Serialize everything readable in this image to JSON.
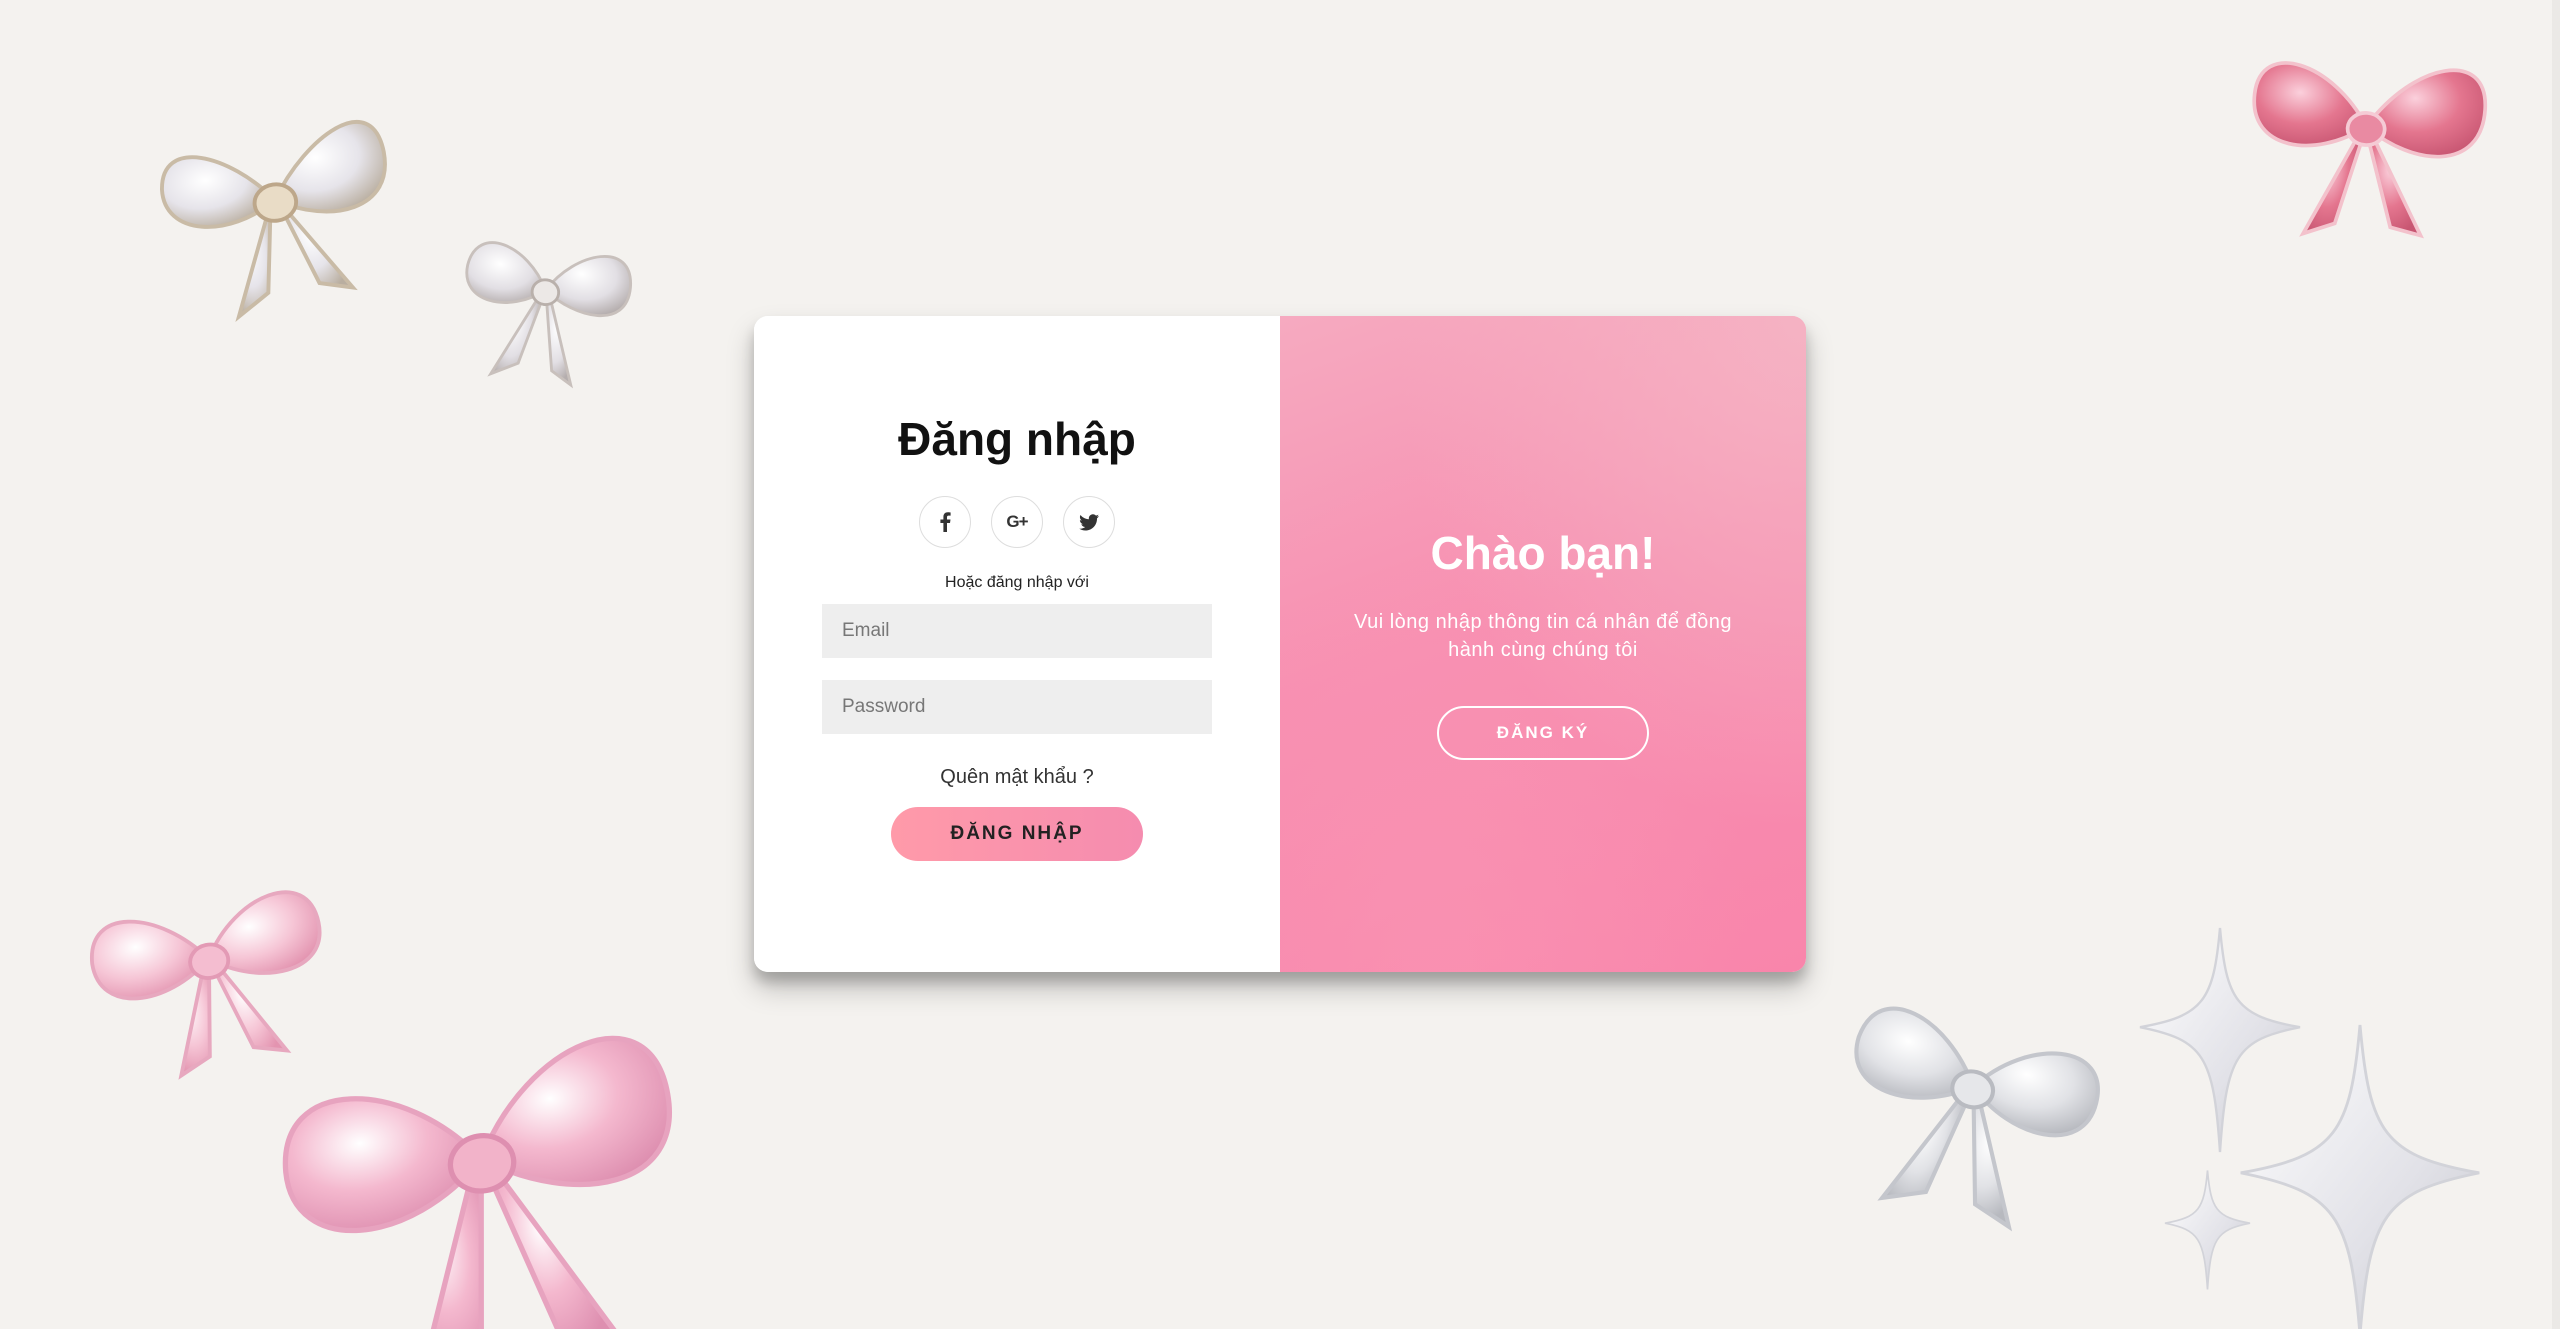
{
  "login": {
    "title": "Đăng nhập",
    "socials": [
      {
        "name": "facebook",
        "label": "f",
        "icon": "facebook-icon"
      },
      {
        "name": "google-plus",
        "label": "G+",
        "icon": "google-plus-icon"
      },
      {
        "name": "twitter",
        "label": "twitter",
        "icon": "twitter-icon"
      }
    ],
    "or_text": "Hoặc đăng nhập với",
    "email_placeholder": "Email",
    "password_placeholder": "Password",
    "forgot_text": "Quên mật khẩu ?",
    "submit_label": "ĐĂNG NHẬP"
  },
  "welcome": {
    "title": "Chào bạn!",
    "description": "Vui lòng nhập thông tin cá nhân để đồng hành cùng chúng tôi",
    "signup_label": "ĐĂNG KÝ"
  },
  "colors": {
    "background": "#f4f2ef",
    "accent_pink": "#f78fb1",
    "button_pink": "#ff9aa9",
    "input_bg": "#eeeeee"
  }
}
